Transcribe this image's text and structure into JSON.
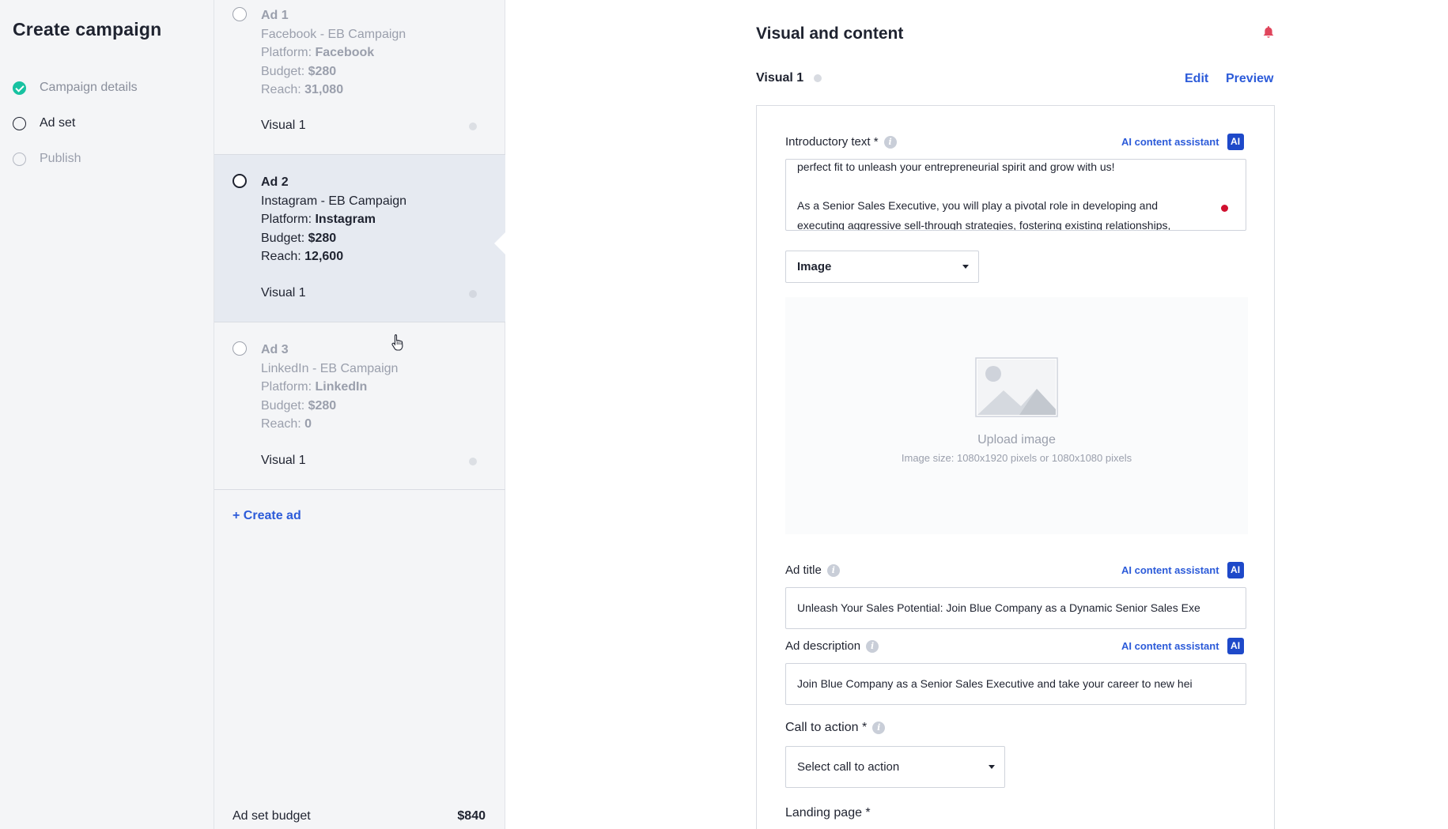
{
  "nav": {
    "title": "Create campaign",
    "steps": [
      {
        "label": "Campaign details",
        "state": "done"
      },
      {
        "label": "Ad set",
        "state": "active"
      },
      {
        "label": "Publish",
        "state": "todo"
      }
    ]
  },
  "ads": [
    {
      "title": "Ad 1",
      "campaign": "Facebook - EB Campaign",
      "platform_label": "Platform:",
      "platform": "Facebook",
      "budget_label": "Budget:",
      "budget": "$280",
      "reach_label": "Reach:",
      "reach": "31,080",
      "visual": "Visual 1"
    },
    {
      "title": "Ad 2",
      "campaign": "Instagram - EB Campaign",
      "platform_label": "Platform:",
      "platform": "Instagram",
      "budget_label": "Budget:",
      "budget": "$280",
      "reach_label": "Reach:",
      "reach": "12,600",
      "visual": "Visual 1"
    },
    {
      "title": "Ad 3",
      "campaign": "LinkedIn - EB Campaign",
      "platform_label": "Platform:",
      "platform": "LinkedIn",
      "budget_label": "Budget:",
      "budget": "$280",
      "reach_label": "Reach:",
      "reach": "0",
      "visual": "Visual 1"
    }
  ],
  "create_ad": "+ Create ad",
  "ad_set_budget": {
    "label": "Ad set budget",
    "value": "$840"
  },
  "main": {
    "title": "Visual and content",
    "visual_tab": "Visual 1",
    "edit": "Edit",
    "preview": "Preview",
    "ai_assistant": "AI content assistant",
    "ai_badge": "AI",
    "intro": {
      "label": "Introductory text *",
      "line1": "perfect fit to unleash your entrepreneurial spirit and grow with us!",
      "line2": "As a Senior Sales Executive, you will play a pivotal role in developing and",
      "line3": "executing aggressive sell-through strategies, fostering existing relationships,"
    },
    "media_type": "Image",
    "upload": {
      "title": "Upload image",
      "subtitle": "Image size: 1080x1920 pixels or 1080x1080 pixels"
    },
    "ad_title": {
      "label": "Ad title",
      "value": "Unleash Your Sales Potential: Join Blue Company as a Dynamic Senior Sales Exe"
    },
    "ad_description": {
      "label": "Ad description",
      "value": "Join Blue Company as a Senior Sales Executive and take your career to new hei"
    },
    "cta": {
      "label": "Call to action *",
      "value": "Select call to action"
    },
    "landing_page": {
      "label": "Landing page *"
    }
  },
  "colors": {
    "accent": "#2c5bd9",
    "ai_badge": "#1e49c9",
    "success": "#17c2a1",
    "alert": "#d0102f"
  }
}
